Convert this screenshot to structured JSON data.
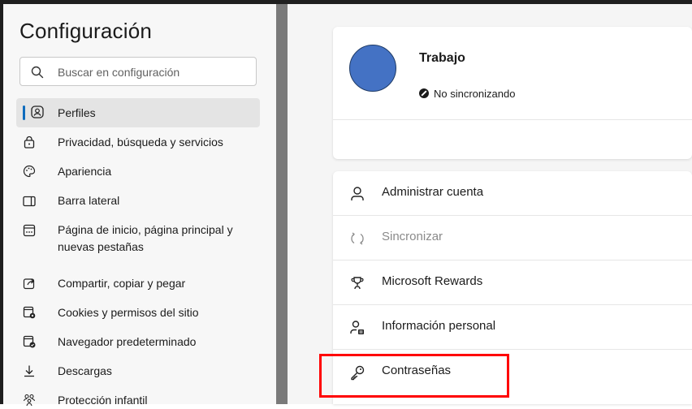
{
  "sidebar": {
    "title": "Configuración",
    "search_placeholder": "Buscar en configuración",
    "items": [
      {
        "label": "Perfiles",
        "icon": "profile-icon"
      },
      {
        "label": "Privacidad, búsqueda y servicios",
        "icon": "lock-icon"
      },
      {
        "label": "Apariencia",
        "icon": "palette-icon"
      },
      {
        "label": "Barra lateral",
        "icon": "sidebar-icon"
      },
      {
        "label": "Página de inicio, página principal y nuevas pestañas",
        "icon": "home-page-icon"
      },
      {
        "label": "Compartir, copiar y pegar",
        "icon": "share-icon"
      },
      {
        "label": "Cookies y permisos del sitio",
        "icon": "cookie-permissions-icon"
      },
      {
        "label": "Navegador predeterminado",
        "icon": "default-browser-icon"
      },
      {
        "label": "Descargas",
        "icon": "download-icon"
      },
      {
        "label": "Protección infantil",
        "icon": "family-icon"
      }
    ]
  },
  "profile": {
    "name": "Trabajo",
    "sync_status": "No sincronizando",
    "avatar_color": "#4472c4"
  },
  "options": [
    {
      "label": "Administrar cuenta",
      "icon": "person-icon",
      "enabled": true
    },
    {
      "label": "Sincronizar",
      "icon": "sync-icon",
      "enabled": false
    },
    {
      "label": "Microsoft Rewards",
      "icon": "trophy-icon",
      "enabled": true
    },
    {
      "label": "Información personal",
      "icon": "personal-info-icon",
      "enabled": true
    },
    {
      "label": "Contraseñas",
      "icon": "key-icon",
      "enabled": true
    }
  ],
  "colors": {
    "accent": "#0f6cbd",
    "highlight_box": "#ff0000"
  }
}
